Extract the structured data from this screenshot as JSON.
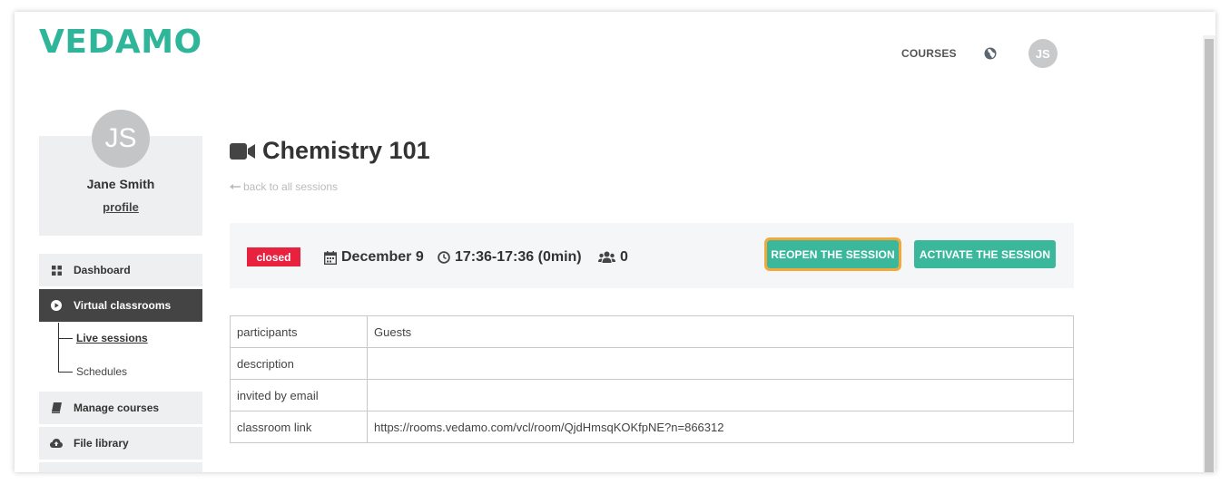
{
  "brand": {
    "logo_text": "VEDAMO",
    "accent": "#2fb59a"
  },
  "topnav": {
    "courses": "COURSES",
    "user_initials": "JS"
  },
  "profile": {
    "initials": "JS",
    "name": "Jane Smith",
    "link": "profile"
  },
  "sidebar": {
    "items": [
      {
        "label": "Dashboard",
        "icon": "grid-icon"
      },
      {
        "label": "Virtual classrooms",
        "icon": "play-circle-icon",
        "active": true
      },
      {
        "label": "Manage courses",
        "icon": "book-icon"
      },
      {
        "label": "File library",
        "icon": "cloud-upload-icon"
      }
    ],
    "subitems": [
      {
        "label": "Live sessions",
        "current": true
      },
      {
        "label": "Schedules"
      }
    ]
  },
  "session": {
    "title": "Chemistry 101",
    "back_link": "back to all sessions",
    "status": "closed",
    "status_color": "#e8213f",
    "date": "December 9",
    "time": "17:36-17:36 (0min)",
    "participants_count": "0",
    "reopen_label": "REOPEN THE SESSION",
    "activate_label": "ACTIVATE THE SESSION",
    "button_color": "#3bb89c",
    "highlight_color": "#f3a93a"
  },
  "details": [
    {
      "key": "participants",
      "value": "Guests"
    },
    {
      "key": "description",
      "value": ""
    },
    {
      "key": "invited by email",
      "value": ""
    },
    {
      "key": "classroom link",
      "value": "https://rooms.vedamo.com/vcl/room/QjdHmsqKOKfpNE?n=866312"
    }
  ]
}
